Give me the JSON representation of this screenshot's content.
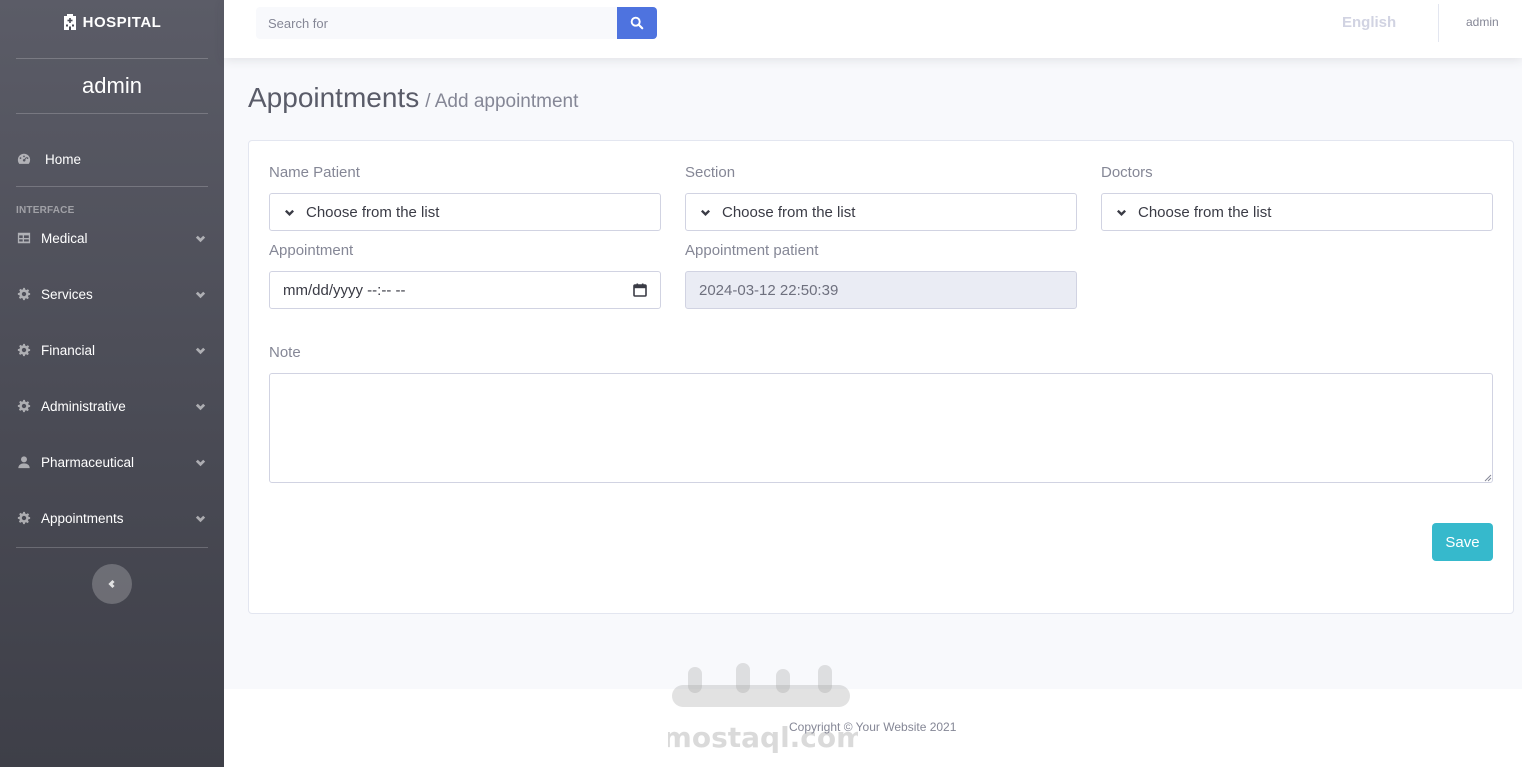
{
  "brand": {
    "name": "HOSPITAL",
    "icon": "hospital-icon"
  },
  "sidebar": {
    "user": "admin",
    "home": {
      "label": "Home",
      "icon": "dashboard-icon"
    },
    "section_heading": "INTERFACE",
    "items": [
      {
        "label": "Medical",
        "icon": "table-icon"
      },
      {
        "label": "Services",
        "icon": "cog-icon"
      },
      {
        "label": "Financial",
        "icon": "cog-icon"
      },
      {
        "label": "Administrative",
        "icon": "cog-icon"
      },
      {
        "label": "Pharmaceutical",
        "icon": "user-icon"
      },
      {
        "label": "Appointments",
        "icon": "cog-icon"
      }
    ],
    "toggle_icon": "chevron-left-icon"
  },
  "topbar": {
    "search_placeholder": "Search for",
    "language": "English",
    "user": "admin"
  },
  "page": {
    "title": "Appointments",
    "subtitle": "/ Add appointment"
  },
  "form": {
    "name_patient": {
      "label": "Name Patient",
      "value": "Choose from the list"
    },
    "section": {
      "label": "Section",
      "value": "Choose from the list"
    },
    "doctors": {
      "label": "Doctors",
      "value": "Choose from the list"
    },
    "appointment": {
      "label": "Appointment",
      "value": "mm/dd/yyyy --:-- --"
    },
    "appointment_patient": {
      "label": "Appointment patient",
      "value": "2024-03-12 22:50:39"
    },
    "note": {
      "label": "Note",
      "value": ""
    },
    "save_label": "Save"
  },
  "footer": {
    "copyright": "Copyright © Your Website 2021",
    "watermark_latin": "mostaql.com",
    "watermark_arabic": "مستقل"
  },
  "colors": {
    "primary": "#4e73df",
    "info": "#36b9cc",
    "sidebar": "#4a4b55"
  }
}
